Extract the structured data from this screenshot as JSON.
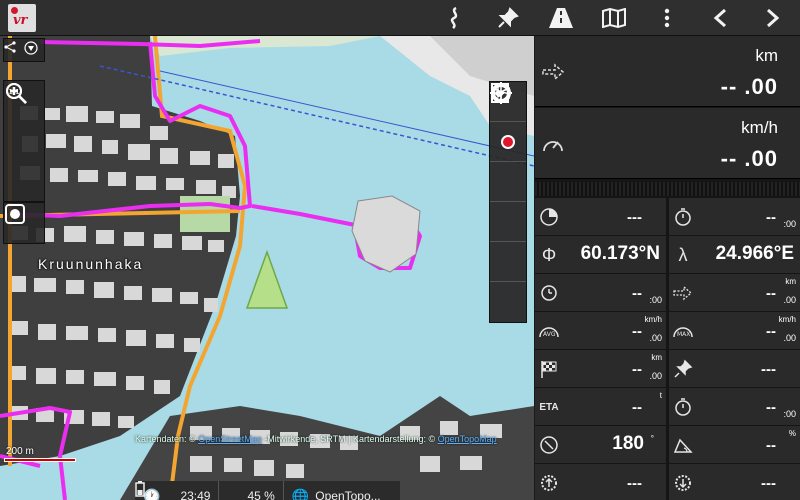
{
  "app": {
    "logo_text": "vr"
  },
  "toolbar": {
    "icons": [
      "route-icon",
      "pin-icon",
      "road-icon",
      "map-icon",
      "menu-icon",
      "back-icon",
      "forward-icon"
    ]
  },
  "map": {
    "place_label": "Kruununhaka",
    "scale_label": "200 m",
    "attribution_prefix": "Kartendaten: ©",
    "attribution_link1": "OpenStreetMap",
    "attribution_mid": "-Mitwirkende, SRTM | Kartendarstellung: ©",
    "attribution_link2": "OpenTopoMap"
  },
  "status": {
    "time": "23:49",
    "battery": "45 %",
    "map_source": "OpenTopo..."
  },
  "panel": {
    "distance": {
      "unit": "km",
      "value": "-- .00"
    },
    "speed": {
      "unit": "km/h",
      "value": "-- .00"
    },
    "cells": {
      "r1c1": {
        "value": "---"
      },
      "r1c2": {
        "value": "--",
        "sub": ":00"
      },
      "lat_symbol": "Φ",
      "lat": "60.173°N",
      "lon_symbol": "λ",
      "lon": "24.966°E",
      "r3c1": {
        "value": "--",
        "sub": ":00"
      },
      "r3c2": {
        "unit": "km",
        "value": "--",
        "sub": ".00"
      },
      "r4c1": {
        "unit": "km/h",
        "value": "--",
        "sub": ".00",
        "badge": "AVG"
      },
      "r4c2": {
        "unit": "km/h",
        "value": "--",
        "sub": ".00",
        "badge": "MAX"
      },
      "r5c1": {
        "unit": "km",
        "value": "--",
        "sub": ".00"
      },
      "r5c2": {
        "value": "---"
      },
      "r6c1": {
        "label": "ETA",
        "unit": "t",
        "value": "--"
      },
      "r6c2": {
        "value": "--",
        "sub": ":00"
      },
      "r7c1": {
        "value": "180",
        "unit": "°"
      },
      "r7c2": {
        "unit": "%",
        "value": "--"
      },
      "r8c1": {
        "value": "---"
      },
      "r8c2": {
        "value": "---"
      }
    }
  }
}
